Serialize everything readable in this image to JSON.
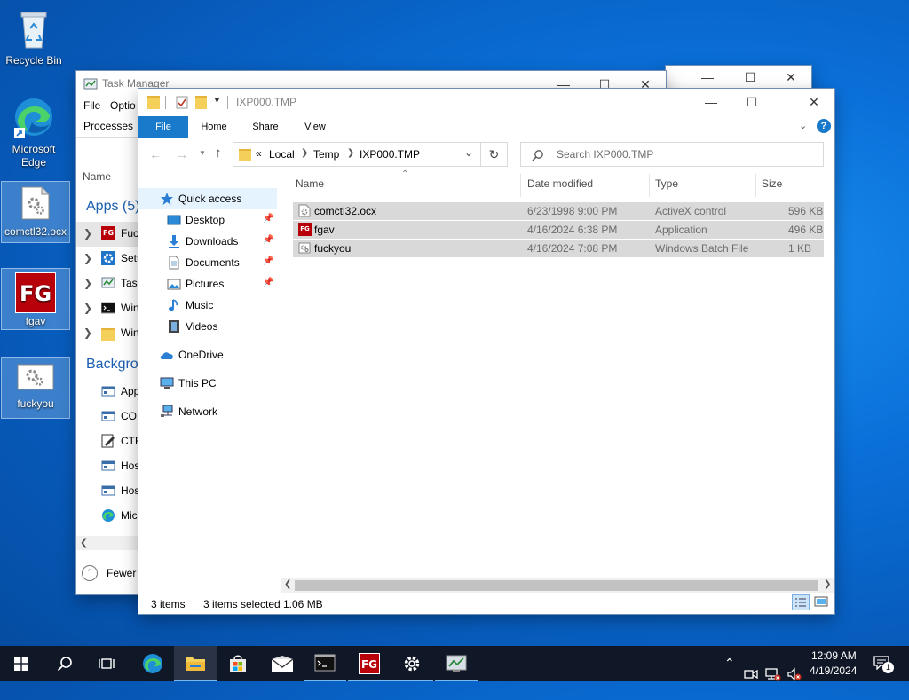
{
  "desktop": {
    "icons": [
      {
        "label": "Recycle Bin"
      },
      {
        "label": "Microsoft Edge"
      },
      {
        "label": "comctl32.ocx"
      },
      {
        "label": "fgav"
      },
      {
        "label": "fuckyou"
      }
    ]
  },
  "task_manager": {
    "title": "Task Manager",
    "menu": [
      "File",
      "Optio"
    ],
    "tab": "Processes",
    "name_header": "Name",
    "apps_header": "Apps (5)",
    "apps": [
      "Fuc",
      "Sett",
      "Task",
      "Win",
      "Win"
    ],
    "background_header": "Backgrou",
    "background": [
      "App",
      "COI",
      "CTF",
      "Hos",
      "Hos",
      "Mic"
    ],
    "fewer_details": "Fewer"
  },
  "explorer": {
    "title": "IXP000.TMP",
    "ribbon_tabs": [
      "File",
      "Home",
      "Share",
      "View"
    ],
    "address": {
      "prefix": "«",
      "crumbs": [
        "Local",
        "Temp",
        "IXP000.TMP"
      ]
    },
    "search_placeholder": "Search IXP000.TMP",
    "nav": {
      "quick_access": "Quick access",
      "pinned": [
        "Desktop",
        "Downloads",
        "Documents",
        "Pictures"
      ],
      "unpinned": [
        "Music",
        "Videos"
      ],
      "onedrive": "OneDrive",
      "this_pc": "This PC",
      "network": "Network"
    },
    "columns": {
      "name": "Name",
      "date": "Date modified",
      "type": "Type",
      "size": "Size"
    },
    "files": [
      {
        "name": "comctl32.ocx",
        "date": "6/23/1998 9:00 PM",
        "type": "ActiveX control",
        "size": "596 KB",
        "icon": "gear-document-icon"
      },
      {
        "name": "fgav",
        "date": "4/16/2024 6:38 PM",
        "type": "Application",
        "size": "496 KB",
        "icon": "fg-app-icon"
      },
      {
        "name": "fuckyou",
        "date": "4/16/2024 7:08 PM",
        "type": "Windows Batch File",
        "size": "1 KB",
        "icon": "batch-file-icon"
      }
    ],
    "status": {
      "items": "3 items",
      "selected": "3 items selected",
      "size": "1.06 MB"
    }
  },
  "taskbar": {
    "time": "12:09 AM",
    "date": "4/19/2024",
    "notification_count": "1",
    "fg_label": "FG"
  },
  "colors": {
    "file_tab": "#1979ca",
    "selection": "#d9d9d9",
    "taskbar": "#101828",
    "fg_red": "#b8000a"
  }
}
